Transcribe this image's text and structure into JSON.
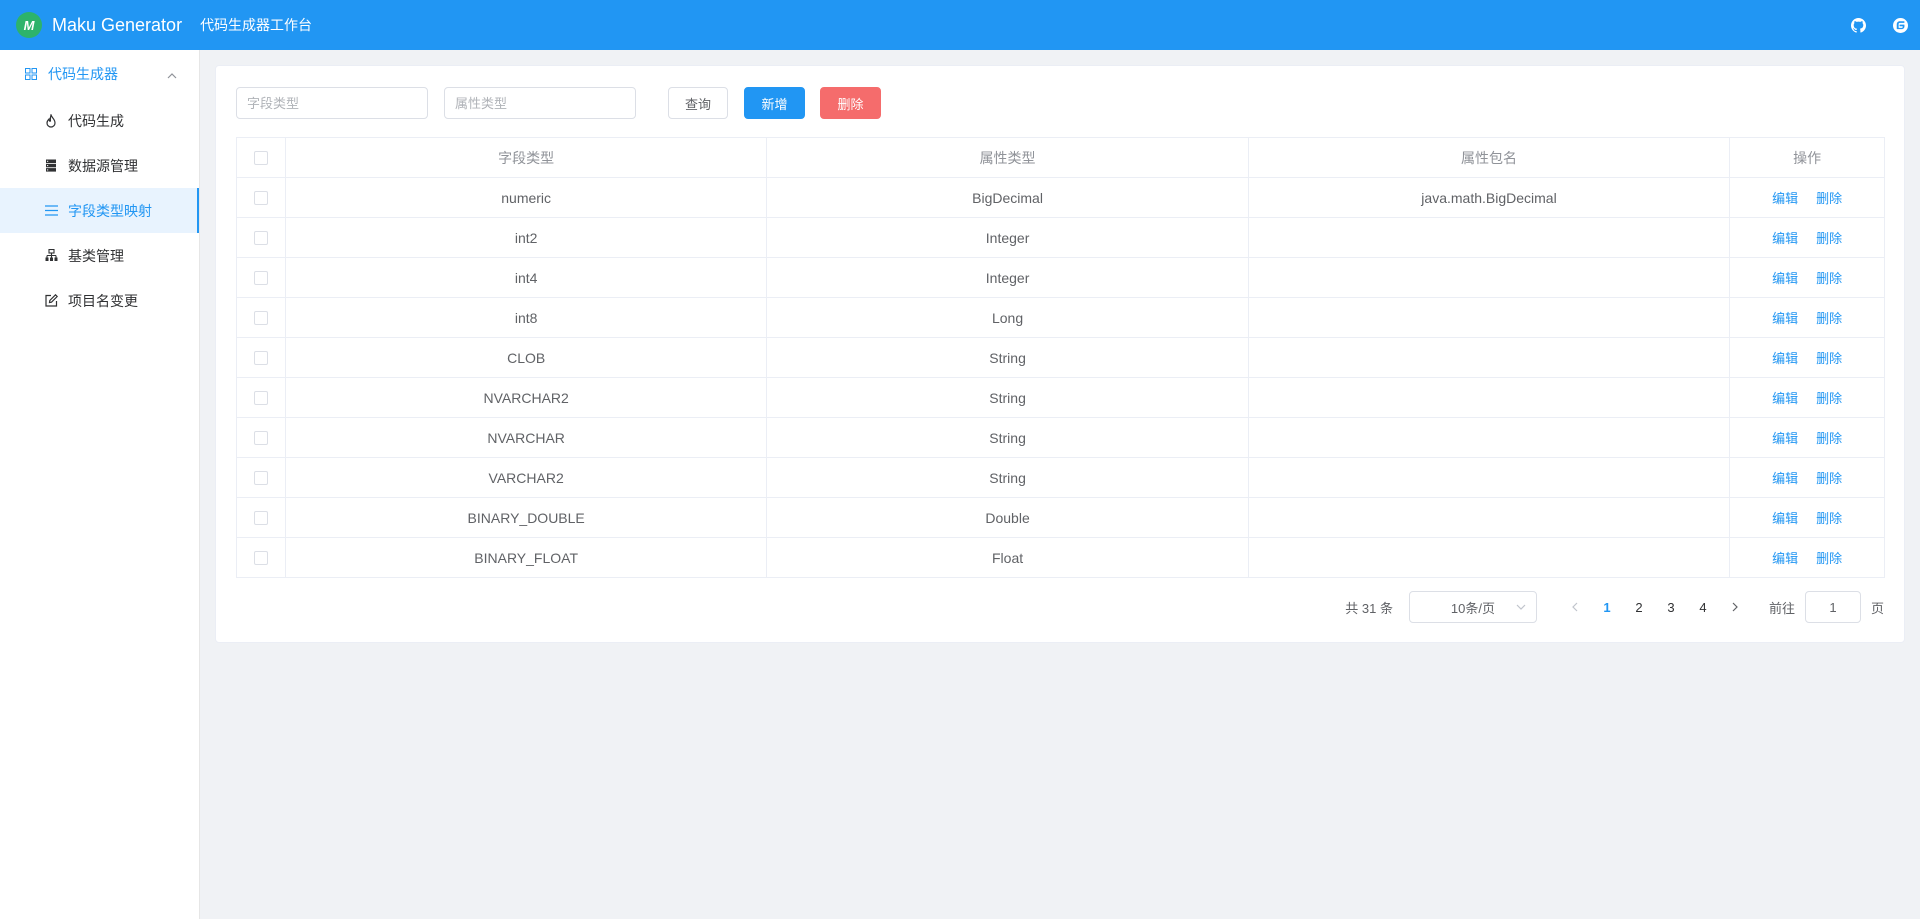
{
  "header": {
    "logo_text": "M",
    "title": "Maku Generator",
    "subtitle": "代码生成器工作台",
    "github_icon": "github-icon",
    "gitee_icon": "gitee-icon",
    "brand_color": "#2196f3"
  },
  "sidebar": {
    "group": {
      "label": "代码生成器",
      "icon": "grid-icon",
      "expanded": true
    },
    "items": [
      {
        "label": "代码生成",
        "icon": "flame-icon"
      },
      {
        "label": "数据源管理",
        "icon": "database-icon"
      },
      {
        "label": "字段类型映射",
        "icon": "list-icon",
        "active": true
      },
      {
        "label": "基类管理",
        "icon": "hierarchy-icon"
      },
      {
        "label": "项目名变更",
        "icon": "edit-icon"
      }
    ]
  },
  "search": {
    "column_type_placeholder": "字段类型",
    "attr_type_placeholder": "属性类型",
    "query_label": "查询",
    "add_label": "新增",
    "delete_label": "删除"
  },
  "table": {
    "headers": [
      "字段类型",
      "属性类型",
      "属性包名",
      "操作"
    ],
    "edit_label": "编辑",
    "delete_label": "删除",
    "rows": [
      {
        "column_type": "numeric",
        "attr_type": "BigDecimal",
        "package_name": "java.math.BigDecimal"
      },
      {
        "column_type": "int2",
        "attr_type": "Integer",
        "package_name": ""
      },
      {
        "column_type": "int4",
        "attr_type": "Integer",
        "package_name": ""
      },
      {
        "column_type": "int8",
        "attr_type": "Long",
        "package_name": ""
      },
      {
        "column_type": "CLOB",
        "attr_type": "String",
        "package_name": ""
      },
      {
        "column_type": "NVARCHAR2",
        "attr_type": "String",
        "package_name": ""
      },
      {
        "column_type": "NVARCHAR",
        "attr_type": "String",
        "package_name": ""
      },
      {
        "column_type": "VARCHAR2",
        "attr_type": "String",
        "package_name": ""
      },
      {
        "column_type": "BINARY_DOUBLE",
        "attr_type": "Double",
        "package_name": ""
      },
      {
        "column_type": "BINARY_FLOAT",
        "attr_type": "Float",
        "package_name": ""
      }
    ]
  },
  "pagination": {
    "total_text": "共 31 条",
    "page_size": "10条/页",
    "pages": [
      "1",
      "2",
      "3",
      "4"
    ],
    "current_page": "1",
    "goto_label": "前往",
    "goto_value": "1",
    "goto_suffix": "页"
  }
}
